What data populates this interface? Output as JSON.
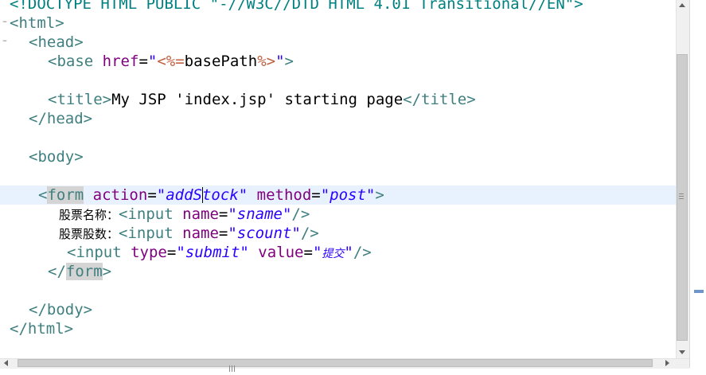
{
  "editor": {
    "doctype_text": "<!DOCTYPE HTML PUBLIC \"-//W3C//DTD HTML 4.01 Transitional//EN\">",
    "html_open": "html",
    "head_open": "head",
    "base_tag": "base",
    "href_attr": "href",
    "base_href_value_open": "\"",
    "jsp_open": "<%=",
    "jsp_expr": "basePath",
    "jsp_close": "%>",
    "base_href_value_close": "\"",
    "title_tag": "title",
    "title_text": "My JSP 'index.jsp' starting page",
    "head_close": "head",
    "body_open": "body",
    "form_tag": "form",
    "action_attr": "action",
    "action_value_a": "\"addS",
    "action_value_b": "tock\"",
    "method_attr": "method",
    "method_value": "\"post\"",
    "label_sname": "股票名称：",
    "input_tag": "input",
    "name_attr": "name",
    "sname_value": "\"sname\"",
    "label_scount": "股票股数：",
    "scount_value": "\"scount\"",
    "type_attr": "type",
    "submit_value": "\"submit\"",
    "value_attr": "value",
    "submit_label": "提交",
    "form_close": "form",
    "body_close": "body",
    "html_close": "html"
  },
  "icons": {
    "fold_minus": "fold-collapse-icon",
    "scroll_up": "arrow-up-icon",
    "scroll_down": "arrow-down-icon",
    "scroll_left": "arrow-left-icon",
    "scroll_right": "arrow-right-icon"
  },
  "colors": {
    "tag": "#3f7f7f",
    "attribute": "#7f007f",
    "string": "#2a00ff",
    "jsp_delimiter": "#bf5f3f",
    "current_line": "#e8f2fe",
    "matching_tag_highlight": "#d4d4d4"
  }
}
